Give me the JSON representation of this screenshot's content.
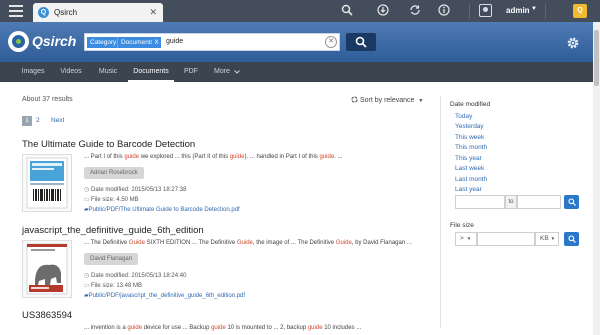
{
  "topbar": {
    "tab_label": "Qsirch",
    "tab_icon": "qsirch-tab-icon",
    "username": "admin",
    "icons": [
      "menu-icon",
      "search-icon",
      "download-icon",
      "sync-icon",
      "info-icon",
      "user-icon",
      "qnap-logo-icon"
    ]
  },
  "header": {
    "logo_text": "Qsirch",
    "chip_category": "Category",
    "chip_value": "Documents",
    "chip_remove": "X",
    "query": "guide",
    "accent_color": "#3b8be0"
  },
  "nav": {
    "tabs": [
      {
        "label": "Images"
      },
      {
        "label": "Videos"
      },
      {
        "label": "Music"
      },
      {
        "label": "Documents"
      },
      {
        "label": "PDF"
      },
      {
        "label": "More"
      }
    ],
    "active": "Documents"
  },
  "results": {
    "count_text": "About 37 results",
    "sort_text": "Sort by relevance",
    "pages": [
      "1",
      "2",
      "Next"
    ],
    "items": [
      {
        "title": "The Ultimate Guide to Barcode Detection",
        "snippet": [
          {
            "t": "... Part I of this ",
            "h": false
          },
          {
            "t": "guide",
            "h": true
          },
          {
            "t": " we explored ... this (Part II of this ",
            "h": false
          },
          {
            "t": "guide",
            "h": true
          },
          {
            "t": "). ... handled in Part I of this ",
            "h": false
          },
          {
            "t": "guide",
            "h": true
          },
          {
            "t": ". ...",
            "h": false
          }
        ],
        "author": "Adrian Rosebrock",
        "date": "Date modified: 2015/05/13 18:27:38",
        "size": "File size: 4.50 MB",
        "path": "Public/PDF/The Ultimate Guide to Barcode Detection.pdf"
      },
      {
        "title": "javascript_the_definitive_guide_6th_edition",
        "snippet": [
          {
            "t": "... The Definitive ",
            "h": false
          },
          {
            "t": "Guide",
            "h": true
          },
          {
            "t": " SIXTH EDITION ... The Definitive ",
            "h": false
          },
          {
            "t": "Guide",
            "h": true
          },
          {
            "t": ", the image of ... The Definitive ",
            "h": false
          },
          {
            "t": "Guide",
            "h": true
          },
          {
            "t": ", by David Flanagan ...",
            "h": false
          }
        ],
        "author": "David Flanagan",
        "date": "Date modified: 2015/05/13 18:24:40",
        "size": "File size: 13.48 MB",
        "path": "Public/PDF/javascript_the_definitive_guide_6th_edition.pdf"
      },
      {
        "title": "US3863594",
        "snippet": [
          {
            "t": "... invention is a ",
            "h": false
          },
          {
            "t": "guide",
            "h": true
          },
          {
            "t": " device for use ... Backup ",
            "h": false
          },
          {
            "t": "guide",
            "h": true
          },
          {
            "t": " 10 is mounted to ... 2, backup ",
            "h": false
          },
          {
            "t": "guide",
            "h": true
          },
          {
            "t": " 10 includes ...",
            "h": false
          }
        ]
      }
    ]
  },
  "filters": {
    "date_heading": "Date modified",
    "date_links": [
      "Today",
      "Yesterday",
      "This week",
      "This month",
      "This year",
      "Last week",
      "Last month",
      "Last year"
    ],
    "date_to": "to",
    "size_heading": "File size",
    "size_op": ">",
    "size_unit": "KB"
  }
}
